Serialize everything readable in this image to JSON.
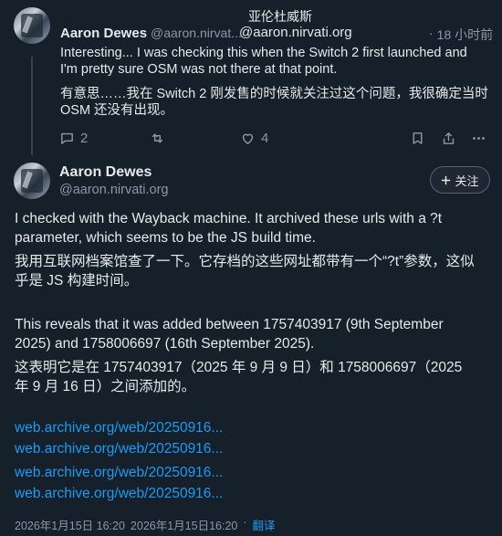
{
  "top_header": {
    "translated_name": "亚伦杜威斯"
  },
  "reply": {
    "author_name": "Aaron Dewes",
    "author_handle_truncated": "@aaron.nirvat...",
    "author_handle_full": "@aaron.nirvati.org",
    "time_sep": "·",
    "time_ago": "18 小时前",
    "text_en": "Interesting... I was checking this when the Switch 2 first launched and\nI'm pretty sure OSM was not there at that point.",
    "text_zh": "有意思……我在 Switch 2 刚发售的时候就关注过这个问题，我很确定当时\nOSM 还没有出现。",
    "actions": {
      "reply_count": "2",
      "like_count": "4"
    }
  },
  "main_post": {
    "author_name": "Aaron Dewes",
    "author_handle": "@aaron.nirvati.org",
    "follow_label": "关注",
    "p1_en": "I checked with the Wayback machine. It archived these urls with a ?t\nparameter, which seems to be the JS build time.",
    "p1_zh": "我用互联网档案馆查了一下。它存档的这些网址都带有一个“?t”参数，这似\n乎是 JS 构建时间。",
    "p2_en": "This reveals that it was added between 1757403917 (9th September\n2025) and 1758006697 (16th September 2025).",
    "p2_zh": "这表明它是在 1757403917（2025 年 9 月 9 日）和 1758006697（2025\n年 9 月 16 日）之间添加的。",
    "links": [
      "web.archive.org/web/20250916...",
      "web.archive.org/web/20250916...",
      "web.archive.org/web/20250916...",
      "web.archive.org/web/20250916..."
    ],
    "timestamp_1": "2026年1月15日 16:20",
    "timestamp_2": "2026年1月15日16:20",
    "timestamp_sep": "·",
    "translate_label": "翻译"
  }
}
